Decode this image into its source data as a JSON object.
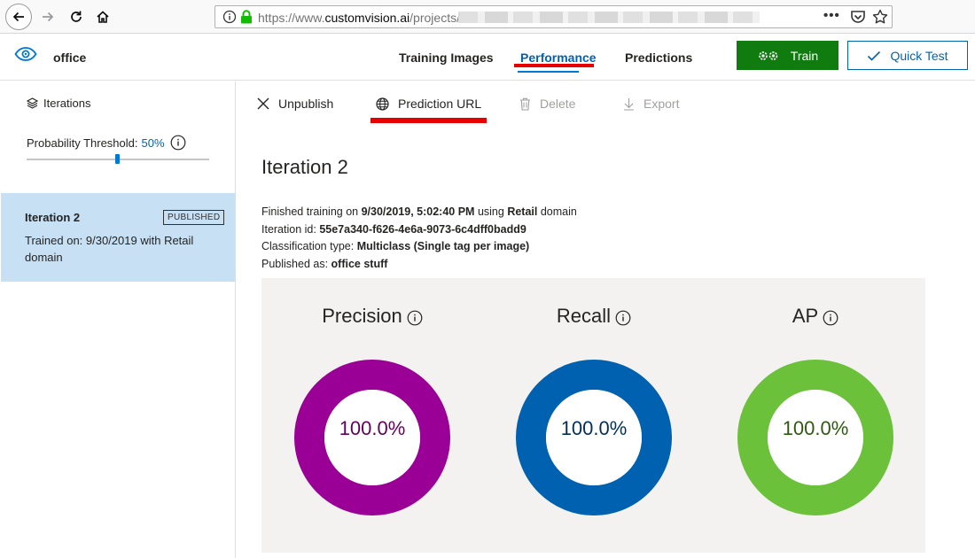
{
  "browser": {
    "url_scheme_prefix": "https://www.",
    "url_host": "customvision.ai",
    "url_path": "/projects/",
    "menu_label": "•••"
  },
  "header": {
    "project_name": "office",
    "tabs": [
      {
        "label": "Training Images",
        "active": false
      },
      {
        "label": "Performance",
        "active": true
      },
      {
        "label": "Predictions",
        "active": false
      }
    ],
    "train_label": "Train",
    "quick_test_label": "Quick Test"
  },
  "sidebar": {
    "iterations_label": "Iterations",
    "probability_label": "Probability Threshold:",
    "probability_value": "50%",
    "probability_fraction": 0.5,
    "iteration_card": {
      "title": "Iteration 2",
      "badge": "PUBLISHED",
      "description": "Trained on: 9/30/2019 with Retail domain"
    }
  },
  "toolbar": {
    "unpublish": "Unpublish",
    "prediction_url": "Prediction URL",
    "delete": "Delete",
    "export": "Export"
  },
  "main": {
    "title": "Iteration 2",
    "details": {
      "finished_prefix": "Finished training on",
      "finished_date": "9/30/2019, 5:02:40 PM",
      "using_text": "using",
      "domain": "Retail",
      "domain_suffix": "domain",
      "iteration_id_label": "Iteration id:",
      "iteration_id": "55e7a340-f626-4e6a-9073-6c4dff0badd9",
      "classification_label": "Classification type:",
      "classification": "Multiclass (Single tag per image)",
      "published_label": "Published as:",
      "published_name": "office stuff"
    },
    "metrics": [
      {
        "label": "Precision",
        "value": "100.0%",
        "fraction": 1.0,
        "color": "#9b0096",
        "text_color": "#630060"
      },
      {
        "label": "Recall",
        "value": "100.0%",
        "fraction": 1.0,
        "color": "#0061b0",
        "text_color": "#00305a"
      },
      {
        "label": "AP",
        "value": "100.0%",
        "fraction": 1.0,
        "color": "#6cc13a",
        "text_color": "#2e5a10"
      }
    ]
  },
  "colors": {
    "accent": "#0078d4",
    "train_green": "#107c10",
    "annotation_red": "#e60000",
    "selected_card": "#c7e0f4"
  }
}
